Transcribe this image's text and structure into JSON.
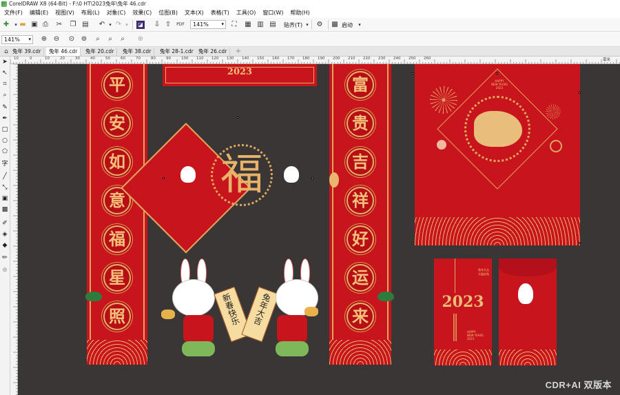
{
  "window": {
    "title": "CorelDRAW X8 (64-Bit) - F:\\0 HT\\2023兔年\\兔年 46.cdr"
  },
  "menubar": [
    {
      "label": "文件(F)"
    },
    {
      "label": "编辑(E)"
    },
    {
      "label": "视图(V)"
    },
    {
      "label": "布局(L)"
    },
    {
      "label": "对象(C)"
    },
    {
      "label": "效果(C)"
    },
    {
      "label": "位图(B)"
    },
    {
      "label": "文本(X)"
    },
    {
      "label": "表格(T)"
    },
    {
      "label": "工具(O)"
    },
    {
      "label": "窗口(W)"
    },
    {
      "label": "帮助(H)"
    }
  ],
  "toolbar": {
    "zoom_value": "141%",
    "snap_label": "贴齐(T)",
    "launch_label": "启动"
  },
  "propbar": {
    "zoom_value": "141%"
  },
  "tabs": [
    {
      "label": "兔年 39.cdr",
      "active": false
    },
    {
      "label": "兔年 46.cdr",
      "active": true
    },
    {
      "label": "兔年 20.cdr",
      "active": false
    },
    {
      "label": "兔年 38.cdr",
      "active": false
    },
    {
      "label": "兔年 28-1.cdr",
      "active": false
    },
    {
      "label": "兔年 26.cdr",
      "active": false
    }
  ],
  "ruler_h": [
    "120",
    "110",
    "100",
    "90",
    "80",
    "70",
    "60",
    "50",
    "40",
    "30",
    "20",
    "10",
    "0",
    "10",
    "20",
    "30",
    "40",
    "50",
    "60",
    "70",
    "80",
    "90",
    "100",
    "110",
    "120",
    "130",
    "140",
    "150",
    "160",
    "170",
    "180",
    "190",
    "200",
    "210",
    "220",
    "230",
    "240",
    "250",
    "260"
  ],
  "ruler_h_unit": "毫米",
  "artwork": {
    "couplet_left": [
      "平",
      "安",
      "如",
      "意",
      "福",
      "星",
      "照"
    ],
    "couplet_right": [
      "富",
      "贵",
      "吉",
      "祥",
      "好",
      "运",
      "来"
    ],
    "banner_year": "2023",
    "fu_char": "福",
    "scroll_left": "新春快乐",
    "scroll_right": "兔年大吉",
    "poster_small_text": "HAPPY\nNEW YEARS\n2023",
    "envelope_year": "2023",
    "envelope_small_text": "兔年大吉\n大展宏兔",
    "envelope_bottom_text": "HAPPY\nNEW YEARS\n2023"
  },
  "watermark": "CDR+AI 双版本",
  "colors": {
    "canvas": "#3a3636",
    "festive_red": "#c8141c",
    "gold": "#f2c27a"
  }
}
